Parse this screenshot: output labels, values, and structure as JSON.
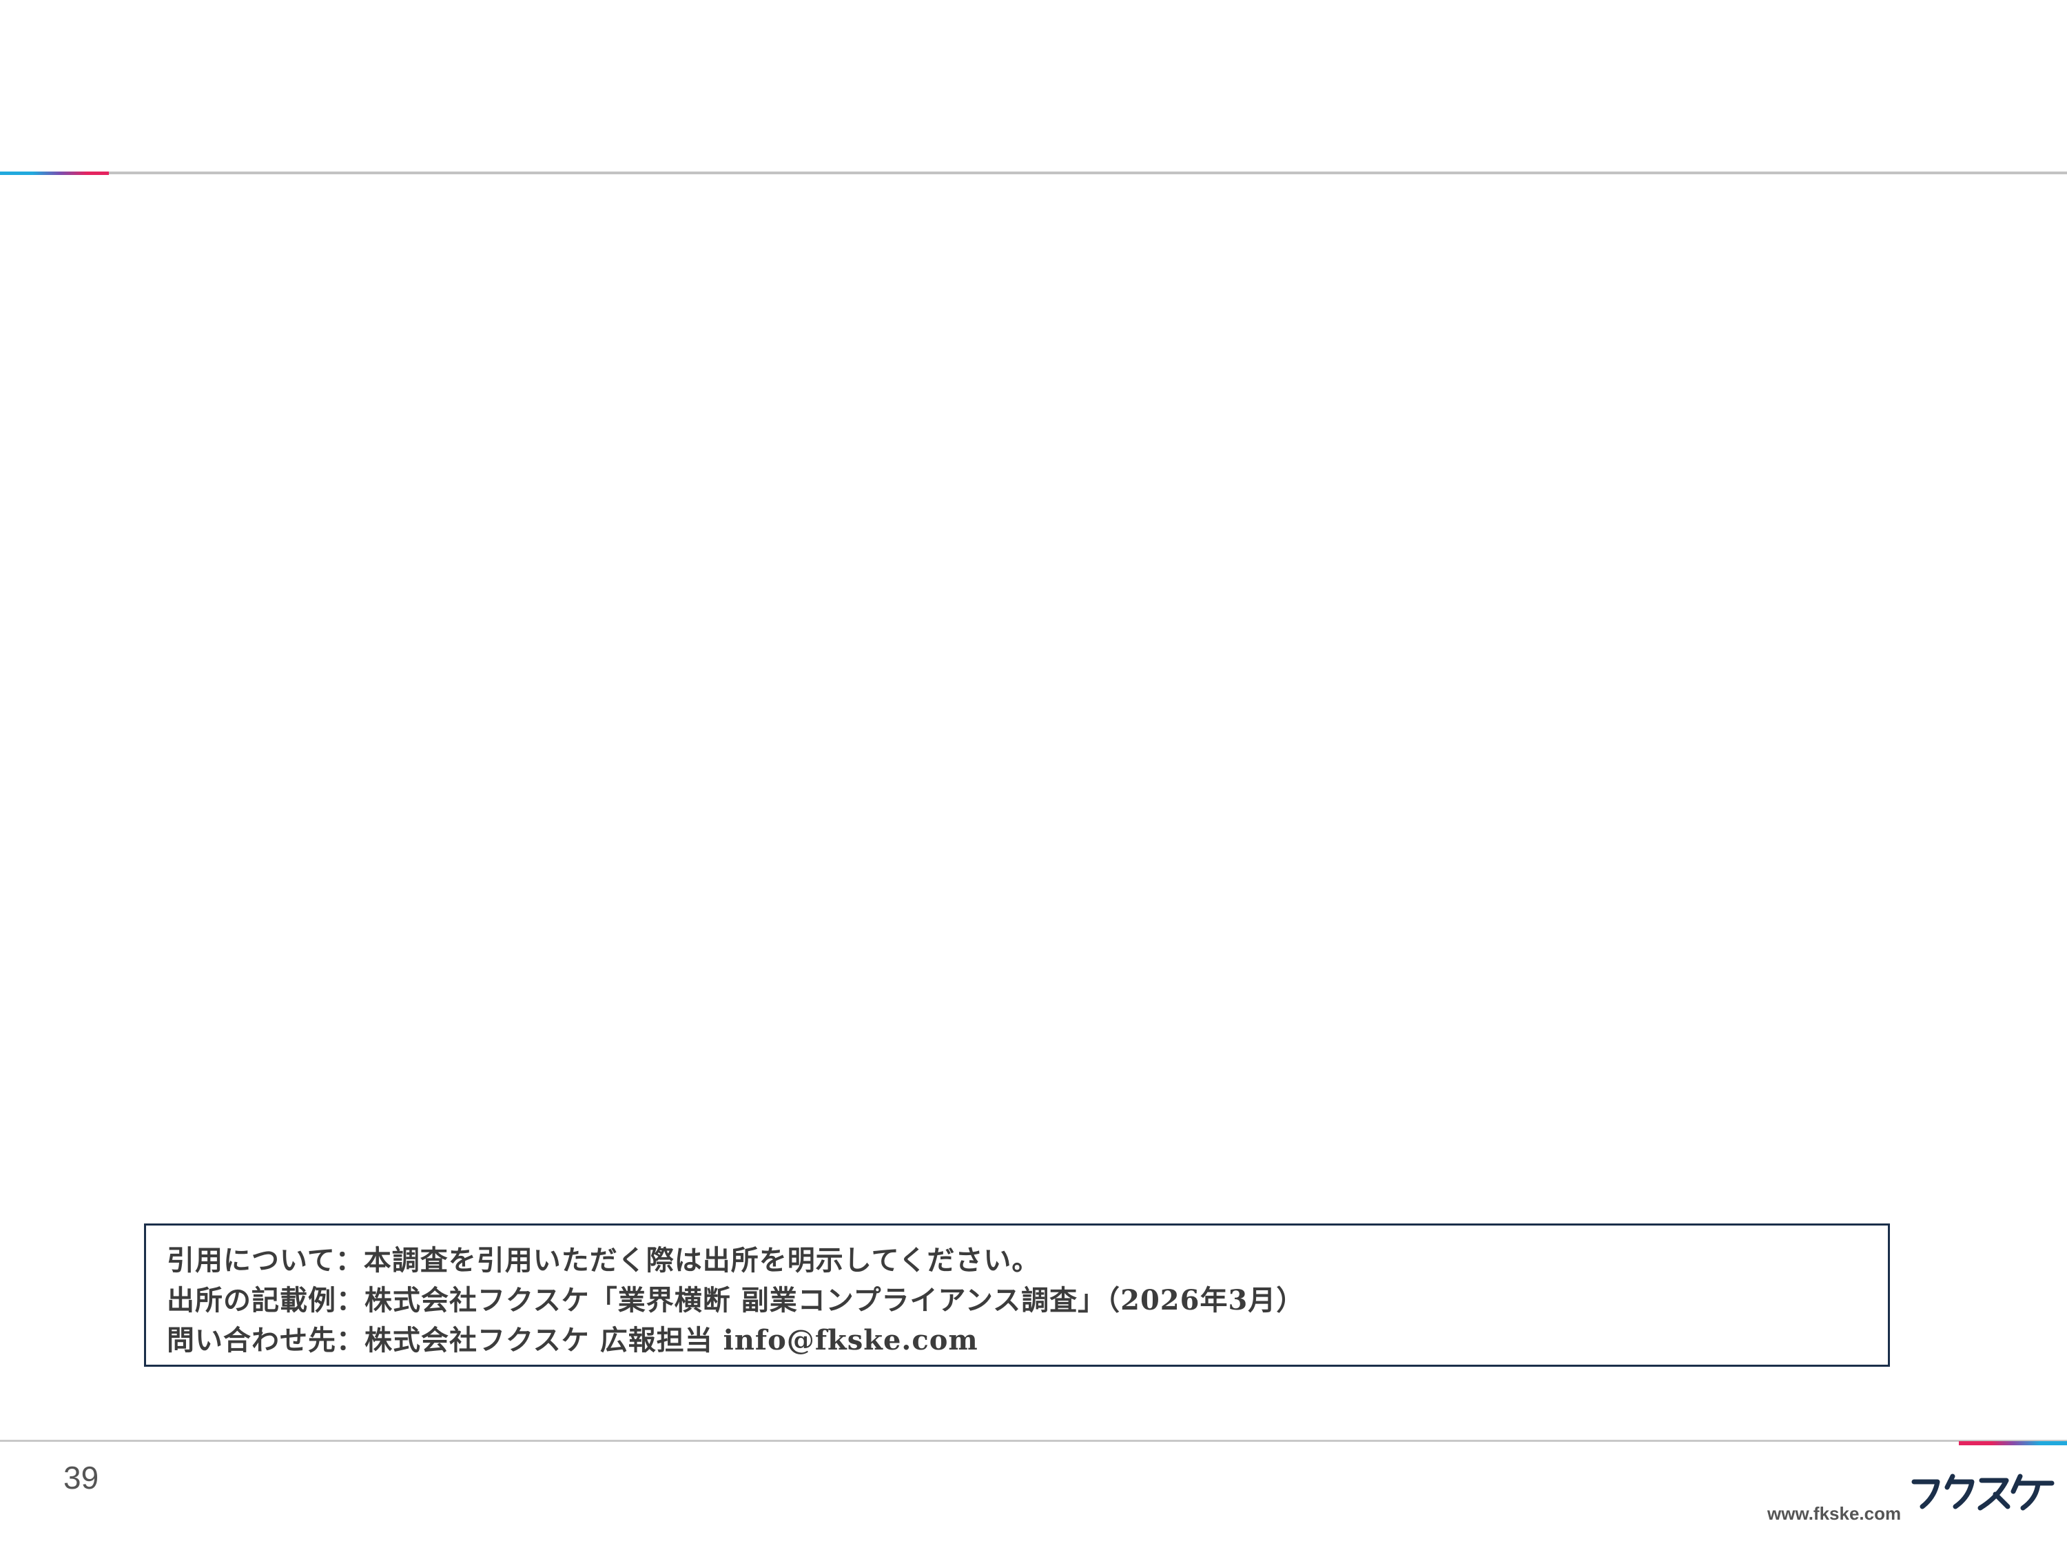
{
  "citation": {
    "lines": [
      "引用について：本調査を引用いただく際は出所を明示してください。",
      "出所の記載例：株式会社フクスケ「業界横断 副業コンプライアンス調査」（2026年3月）",
      "問い合わせ先：株式会社フクスケ 広報担当 info@fkske.com"
    ]
  },
  "footer": {
    "page_number": "39",
    "url": "www.fkske.com",
    "logo_text": "フクスケ"
  },
  "colors": {
    "accent_blue": "#21a9dd",
    "accent_pink": "#e4245f",
    "box_border": "#1b2f4a",
    "text": "#3c3c3c"
  }
}
